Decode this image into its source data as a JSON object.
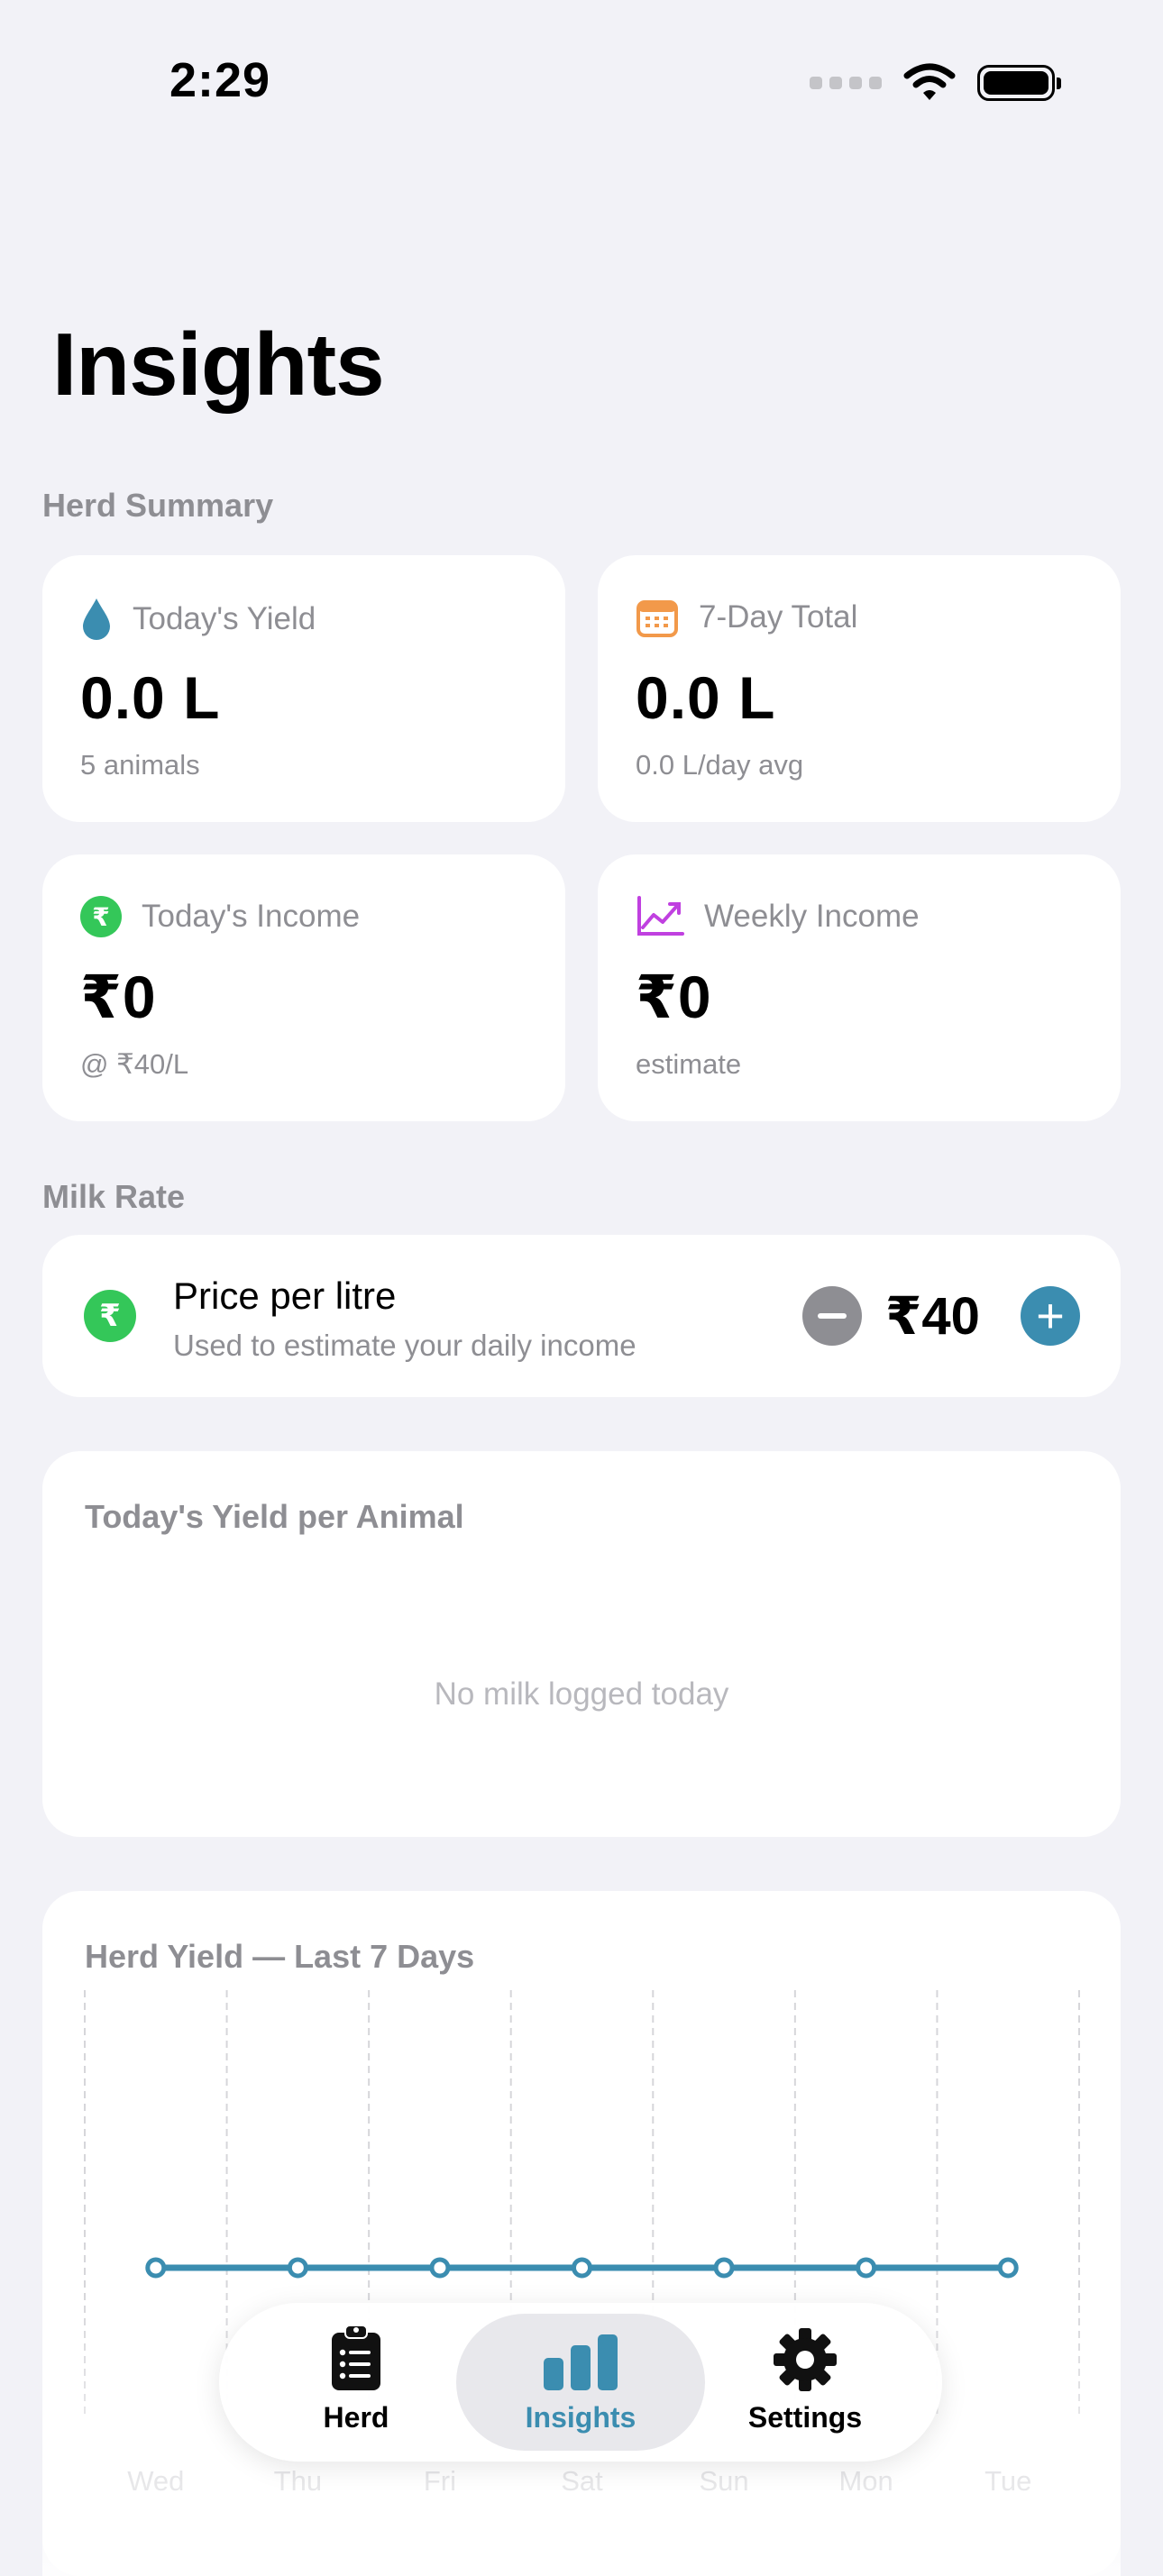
{
  "status_bar": {
    "time": "2:29"
  },
  "header": {
    "title": "Insights"
  },
  "herd_summary": {
    "section_label": "Herd Summary",
    "cards": [
      {
        "icon": "drop-icon",
        "label": "Today's Yield",
        "value": "0.0 L",
        "sub": "5 animals",
        "icon_color": "#3B8DB0"
      },
      {
        "icon": "calendar-icon",
        "label": "7-Day Total",
        "value": "0.0 L",
        "sub": "0.0 L/day avg",
        "icon_color": "#F2994A"
      },
      {
        "icon": "rupee-circle-icon",
        "icon_glyph": "₹",
        "label": "Today's Income",
        "value": "₹0",
        "sub": "@ ₹40/L",
        "icon_color": "#34C759"
      },
      {
        "icon": "trend-chart-icon",
        "label": "Weekly Income",
        "value": "₹0",
        "sub": "estimate",
        "icon_color": "#C040E0"
      }
    ]
  },
  "milk_rate": {
    "section_label": "Milk Rate",
    "icon": "rupee-circle-icon",
    "icon_glyph": "₹",
    "title": "Price per litre",
    "subtitle": "Used to estimate your daily income",
    "value": "₹40",
    "plus_glyph": "+"
  },
  "yield_per_animal": {
    "title": "Today's Yield per Animal",
    "empty_text": "No milk logged today"
  },
  "chart_data": {
    "type": "line",
    "title": "Herd Yield — Last 7 Days",
    "categories": [
      "Wed",
      "Thu",
      "Fri",
      "Sat",
      "Sun",
      "Mon",
      "Tue"
    ],
    "values": [
      0,
      0,
      0,
      0,
      0,
      0,
      0
    ],
    "line_color": "#3B8DB0",
    "grid": "vertical dashed"
  },
  "tabbar": {
    "tabs": [
      {
        "label": "Herd",
        "icon": "clipboard-list-icon",
        "active": false
      },
      {
        "label": "Insights",
        "icon": "bar-chart-icon",
        "active": true
      },
      {
        "label": "Settings",
        "icon": "gear-icon",
        "active": false
      }
    ],
    "active_color": "#3B8DB0"
  }
}
